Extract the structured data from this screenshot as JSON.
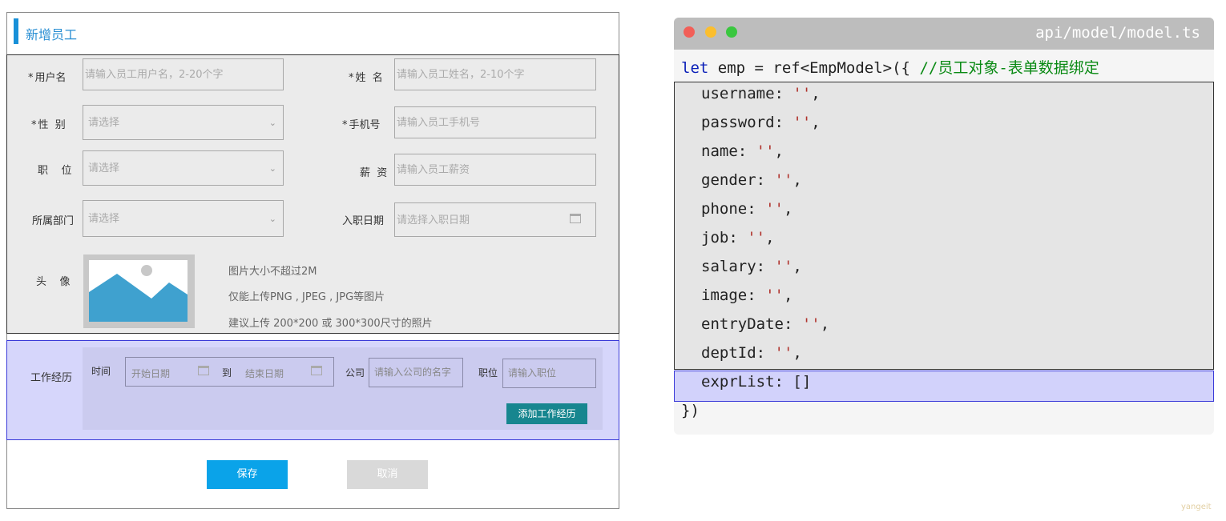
{
  "form": {
    "title": "新增员工",
    "fields": {
      "username": {
        "label": "用户名",
        "required": "*",
        "placeholder": "请输入员工用户名，2-20个字"
      },
      "name": {
        "label": "姓  名",
        "required": "*",
        "placeholder": "请输入员工姓名，2-10个字"
      },
      "gender": {
        "label": "性  别",
        "required": "*",
        "placeholder": "请选择"
      },
      "phone": {
        "label": "手机号",
        "required": "*",
        "placeholder": "请输入员工手机号"
      },
      "job": {
        "label": "职    位",
        "placeholder": "请选择"
      },
      "salary": {
        "label": "薪  资",
        "placeholder": "请输入员工薪资"
      },
      "dept": {
        "label": "所属部门",
        "placeholder": "请选择"
      },
      "entry_date": {
        "label": "入职日期",
        "placeholder": "请选择入职日期"
      }
    },
    "avatar": {
      "label": "头    像",
      "hints": [
        "图片大小不超过2M",
        "仅能上传PNG , JPEG , JPG等图片",
        "建议上传 200*200 或 300*300尺寸的照片"
      ]
    },
    "experience": {
      "label": "工作经历",
      "time_label": "时间",
      "start_placeholder": "开始日期",
      "separator": "到",
      "end_placeholder": "结束日期",
      "company_label": "公司",
      "company_placeholder": "请输入公司的名字",
      "position_label": "职位",
      "position_placeholder": "请输入职位",
      "add_button": "添加工作经历"
    },
    "save_button": "保存",
    "cancel_button": "取消"
  },
  "code": {
    "filename": "api/model/model.ts",
    "line1_kw": "let",
    "line1_code": " emp = ref<EmpModel>({ ",
    "line1_comment": "//员工对象-表单数据绑定",
    "fields": [
      "username",
      "password",
      "name",
      "gender",
      "phone",
      "job",
      "salary",
      "image",
      "entryDate",
      "deptId"
    ],
    "empty_string": "''",
    "last_field": "exprList",
    "last_value": "[]",
    "closing": "})"
  },
  "watermark": "yangeit",
  "colors": {
    "accent_blue": "#0aa3e9",
    "header_blue": "#2a8fd3",
    "teal_button": "#17868f",
    "highlight_purple": "#d2d2fb",
    "mac_red": "#f25f58",
    "mac_yellow": "#fbbe2e",
    "mac_green": "#3ac73f"
  }
}
